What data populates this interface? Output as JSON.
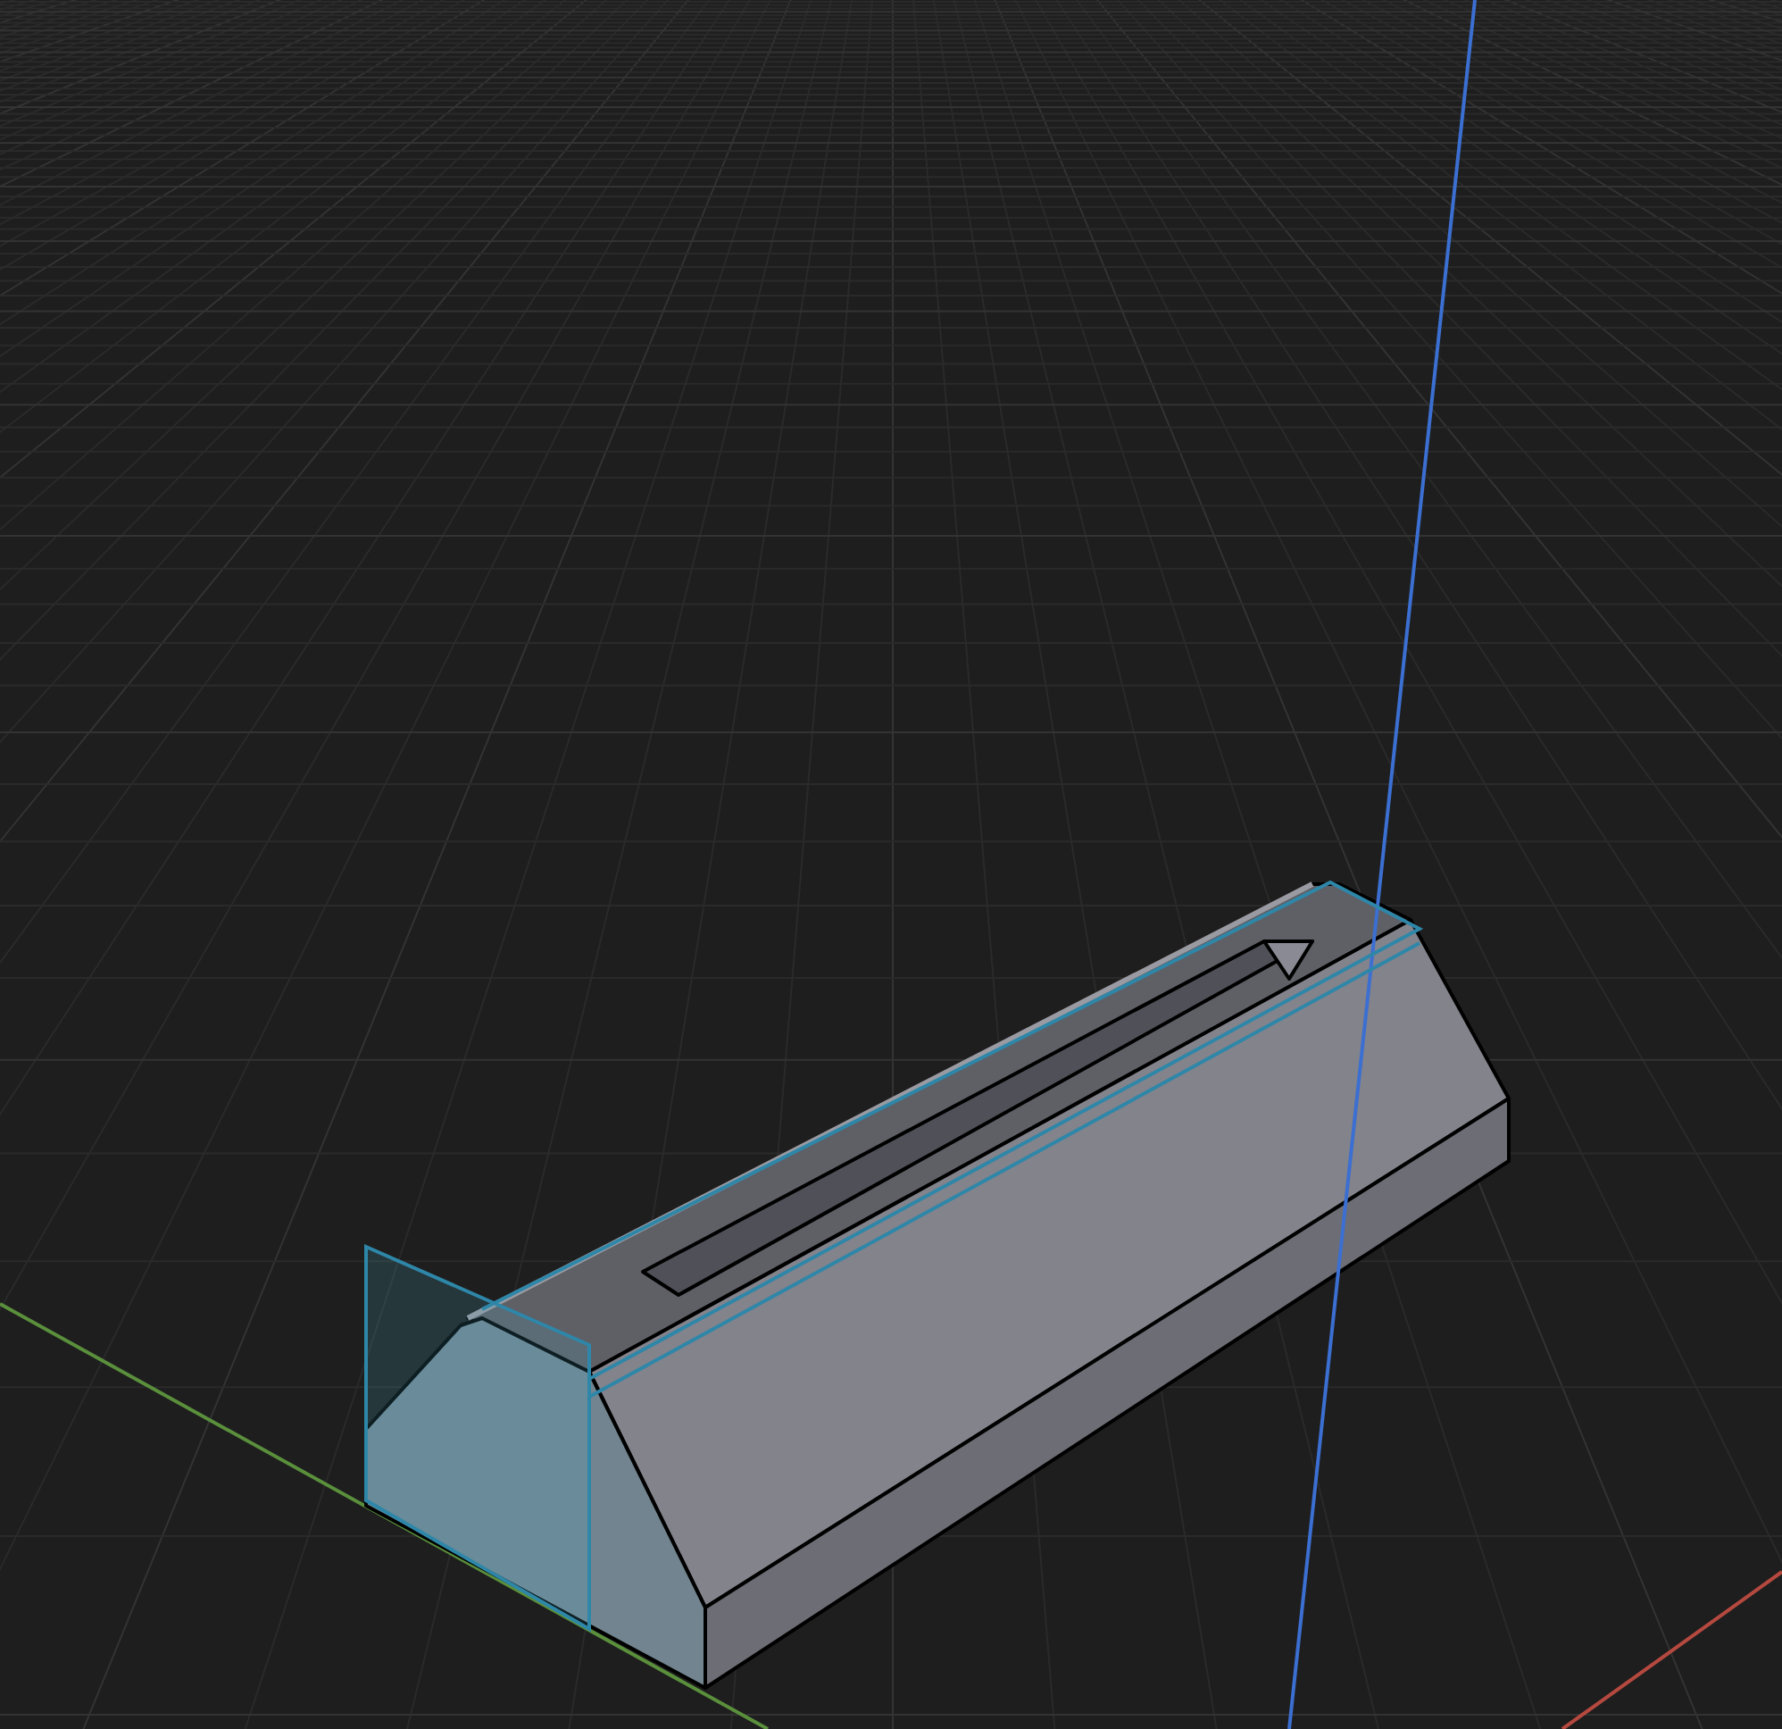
{
  "viewport": {
    "axes": [
      {
        "kind": "x",
        "color": "#b5493f"
      },
      {
        "kind": "y",
        "color": "#5a8f3c"
      },
      {
        "kind": "z",
        "color": "#3b6fd1"
      }
    ],
    "selection": {
      "selected": true
    }
  }
}
